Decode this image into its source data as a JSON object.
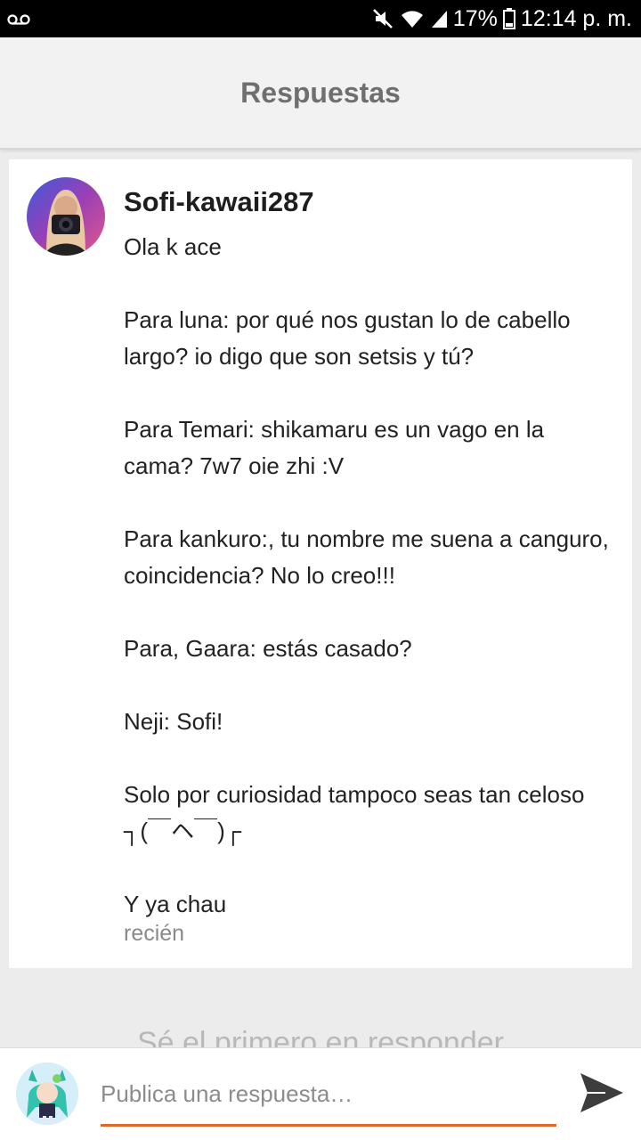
{
  "status_bar": {
    "battery": "17%",
    "time": "12:14 p. m.",
    "icons": [
      "voicemail-icon",
      "mute-icon",
      "wifi-icon",
      "signal-icon",
      "battery-icon"
    ]
  },
  "header": {
    "title": "Respuestas"
  },
  "post": {
    "username": "Sofi-kawaii287",
    "lines": [
      "Ola k ace",
      "",
      "Para luna: por qué nos gustan lo de cabello largo? io digo que son setsis y tú?",
      "",
      "Para Temari: shikamaru es un vago en la cama? 7w7 oie zhi :V",
      "",
      "Para kankuro:, tu nombre me suena a canguro, coincidencia? No lo creo!!!",
      "",
      "Para, Gaara: estás casado?",
      "",
      "Neji: Sofi!",
      "",
      "Solo por curiosidad tampoco seas tan celoso ┐(￣ヘ￣)┌",
      "",
      "Y ya chau"
    ],
    "timestamp": "recién"
  },
  "empty_state": {
    "text": "Sé el primero en responder"
  },
  "reply": {
    "placeholder": "Publica una respuesta…",
    "accent_color": "#e4662d"
  }
}
